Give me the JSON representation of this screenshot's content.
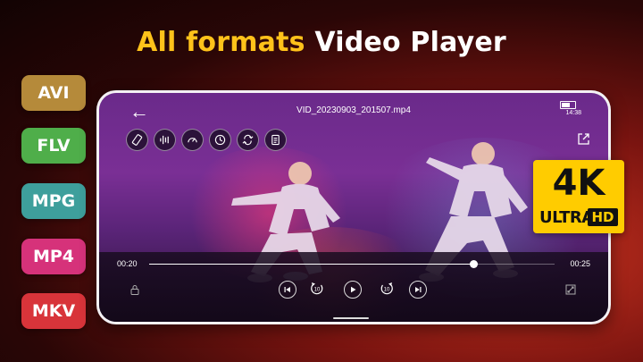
{
  "headline": {
    "accent": "All formats",
    "rest": " Video Player"
  },
  "format_badges": [
    {
      "label": "AVI",
      "color": "#b58a3a"
    },
    {
      "label": "FLV",
      "color": "#4fae4a"
    },
    {
      "label": "MPG",
      "color": "#3e9f9c"
    },
    {
      "label": "MP4",
      "color": "#d6327a"
    },
    {
      "label": "MKV",
      "color": "#d8343a"
    }
  ],
  "player": {
    "filename": "VID_20230903_201507.mp4",
    "clock": "14:38",
    "elapsed": "00:20",
    "duration": "00:25",
    "progress_fraction": 0.8,
    "tool_icons": [
      "screen-rotate-icon",
      "equalizer-icon",
      "speed-icon",
      "sleep-timer-icon",
      "repeat-icon",
      "subtitle-icon"
    ],
    "rewind_seconds": "10",
    "forward_seconds": "10"
  },
  "uhd_badge": {
    "big": "4K",
    "ultra": "ULTRA",
    "hd": "HD"
  }
}
